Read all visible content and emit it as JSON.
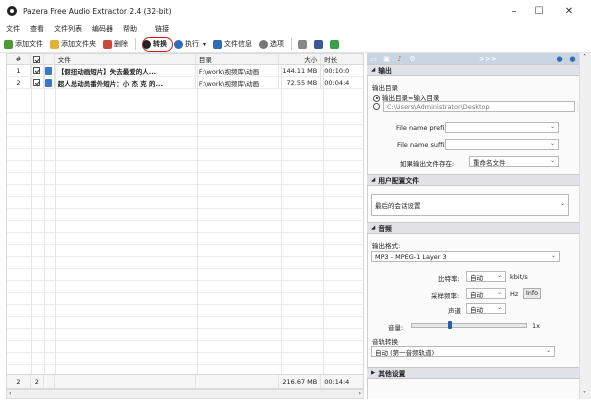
{
  "app": {
    "title": "Pazera Free Audio Extractor 2.4 (32-bit)"
  },
  "window_controls": {
    "minimize": "–",
    "maximize": "☐",
    "close": "✕"
  },
  "menu": [
    "文件",
    "查看",
    "文件列表",
    "编码器",
    "帮助",
    "链接"
  ],
  "toolbar": {
    "add_files": "添加文件",
    "add_folder": "添加文件夹",
    "delete": "删除",
    "convert": "转换",
    "run": "执行",
    "file_info": "文件信息",
    "options": "选项"
  },
  "table": {
    "headers": [
      "#",
      "",
      "",
      "文件",
      "目录",
      "大小",
      "时长"
    ],
    "rows": [
      {
        "num": "1",
        "file": "【假扭动画短片】失去最爱的人...",
        "dir": "F:\\work\\视频库\\动画",
        "size": "144.11 MB",
        "duration": "00:10:0"
      },
      {
        "num": "2",
        "file": "超人总动员番外短片：小 杰 克 的...",
        "dir": "F:\\work\\视频库\\动画",
        "size": "72.55 MB",
        "duration": "00:04:4"
      }
    ],
    "footer": {
      "count1": "2",
      "count2": "2",
      "total_size": "216.67 MB",
      "total_duration": "00:14:4"
    }
  },
  "panel": {
    "tabs_more": ">>>",
    "output_section": "输出",
    "output_dir_label": "输出目录",
    "radio_output_input": "输出目录=输入目录",
    "output_path": "C:\\Users\\Administrator\\Desktop",
    "prefix_label": "File name prefix:",
    "suffix_label": "File name suffix:",
    "exists_label": "如果输出文件存在:",
    "exists_value": "重命名文件",
    "profile_section": "用户配置文件",
    "profile_value": "最后的会话设置",
    "audio_section": "音频",
    "output_format_label": "输出格式:",
    "output_format_value": "MP3 - MPEG-1 Layer 3",
    "bitrate_label": "比特率:",
    "bitrate_value": "自动",
    "bitrate_unit": "kbit/s",
    "samplerate_label": "采样频率:",
    "samplerate_value": "自动",
    "samplerate_unit": "Hz",
    "info_button": "Info",
    "channels_label": "声道",
    "channels_value": "自动",
    "volume_label": "音量:",
    "volume_unit": "1x",
    "volume_level": 0.34,
    "track_label": "音轨转换",
    "track_value": "自动 (第一音频轨道)",
    "other_section": "其他设置"
  }
}
